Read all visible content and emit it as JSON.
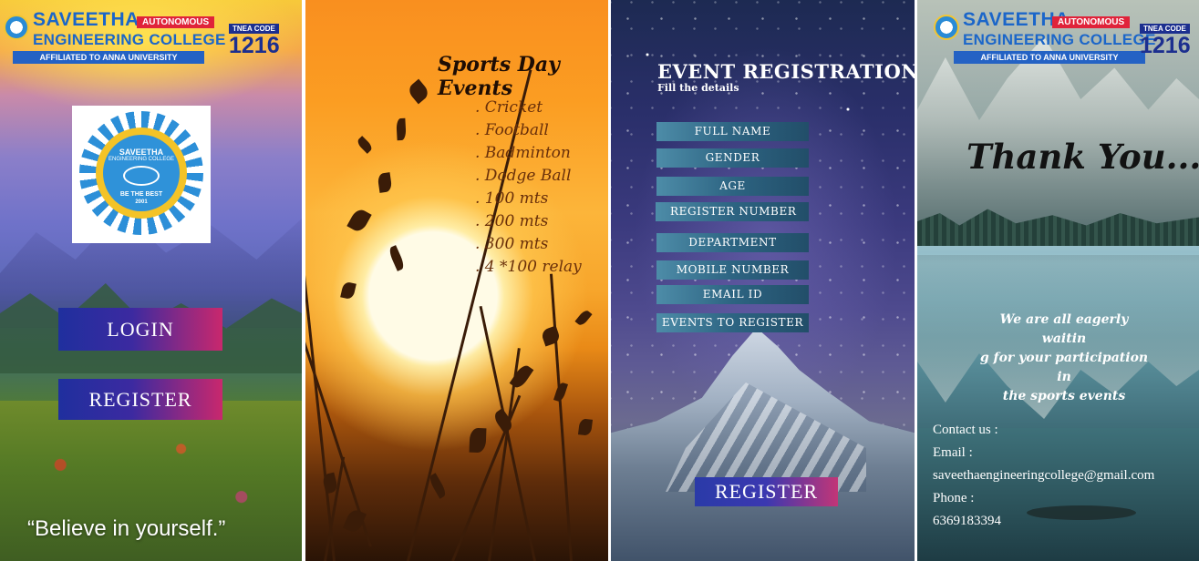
{
  "college": {
    "name_line1": "SAVEETHA",
    "name_line2": "ENGINEERING COLLEGE",
    "affiliation": "AFFILIATED TO ANNA UNIVERSITY",
    "status_badge": "AUTONOMOUS",
    "code_label": "TNEA CODE",
    "code": "1216",
    "logo": {
      "name_top": "SAVEETHA",
      "name_bottom": "ENGINEERING COLLEGE",
      "motto": "BE THE BEST",
      "year": "2001"
    }
  },
  "login_screen": {
    "login_label": "LOGIN",
    "register_label": "REGISTER",
    "tagline": "“Believe in yourself.”"
  },
  "events_screen": {
    "title": "Sports Day Events",
    "events": [
      ". Cricket",
      ". Football",
      ". Badminton",
      ". Dodge Ball",
      ". 100 mts",
      ". 200 mts",
      ". 300 mts",
      ". 4 *100 relay"
    ]
  },
  "form_screen": {
    "title": "EVENT REGISTRATION FORM",
    "subtitle": "Fill the details",
    "fields": [
      "FULL NAME",
      "GENDER",
      "AGE",
      "REGISTER NUMBER",
      "DEPARTMENT",
      "MOBILE NUMBER",
      "EMAIL ID",
      "EVENTS TO REGISTER"
    ],
    "register_label": "REGISTER"
  },
  "thanks_screen": {
    "title": "Thank You.....",
    "message_lines": [
      "We are all eagerly waitin",
      "g for your participation in",
      "the sports events"
    ],
    "contact_lines": [
      "Contact us :",
      "Email :",
      "saveethaengineeringcollege@gmail.com",
      "Phone :",
      "6369183394"
    ]
  },
  "colors": {
    "brand_blue": "#1b66c9",
    "badge_red": "#e0233a",
    "button_gradient_start": "#1f2f9e",
    "button_gradient_end": "#c9286d",
    "form_field": "#2d6482"
  }
}
